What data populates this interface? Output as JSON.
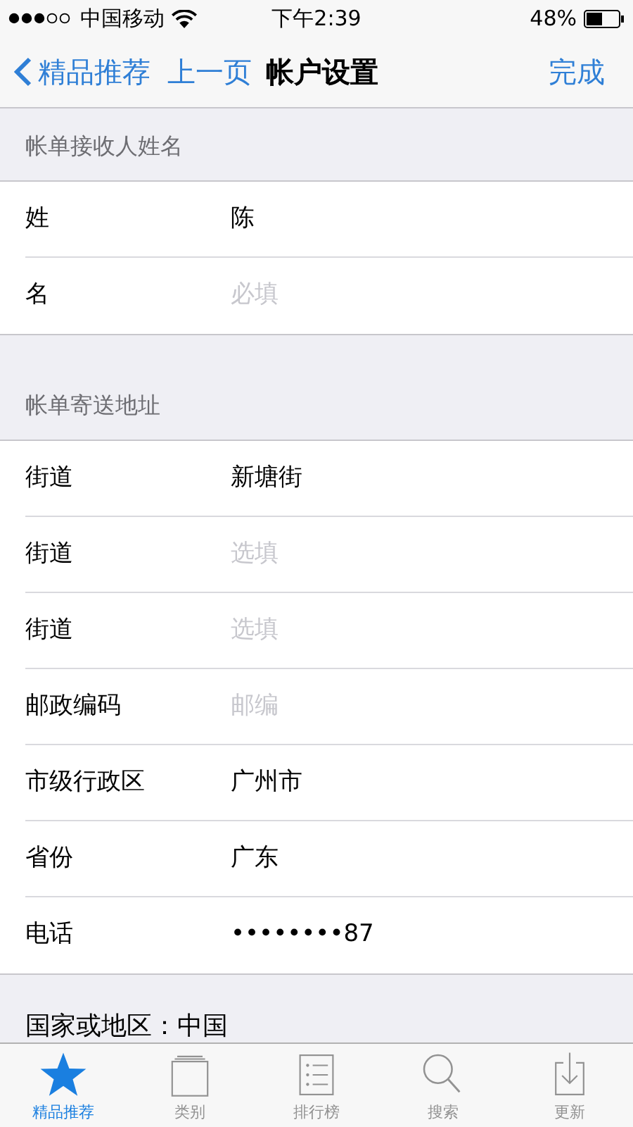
{
  "status_bar": {
    "carrier": "中国移动",
    "time": "下午2:39",
    "battery": "48%"
  },
  "nav": {
    "back": "精品推荐",
    "previous": "上一页",
    "title": "帐户设置",
    "done": "完成"
  },
  "sections": [
    {
      "header": "帐单接收人姓名",
      "rows": [
        {
          "label": "姓",
          "value": "陈"
        },
        {
          "label": "名",
          "placeholder": "必填"
        }
      ]
    },
    {
      "header": "帐单寄送地址",
      "rows": [
        {
          "label": "街道",
          "value": "新塘街"
        },
        {
          "label": "街道",
          "placeholder": "选填"
        },
        {
          "label": "街道",
          "placeholder": "选填"
        },
        {
          "label": "邮政编码",
          "placeholder": "邮编"
        },
        {
          "label": "市级行政区",
          "value": "广州市"
        },
        {
          "label": "省份",
          "value": "广东"
        },
        {
          "label": "电话",
          "value": "••••••••87"
        }
      ]
    }
  ],
  "footer": "国家或地区：中国",
  "tab_bar": [
    {
      "label": "精品推荐",
      "kind": "star",
      "selected": true
    },
    {
      "label": "类别",
      "kind": "stack",
      "selected": false
    },
    {
      "label": "排行榜",
      "kind": "list",
      "selected": false
    },
    {
      "label": "搜索",
      "kind": "search",
      "selected": false
    },
    {
      "label": "更新",
      "kind": "download",
      "selected": false
    }
  ]
}
